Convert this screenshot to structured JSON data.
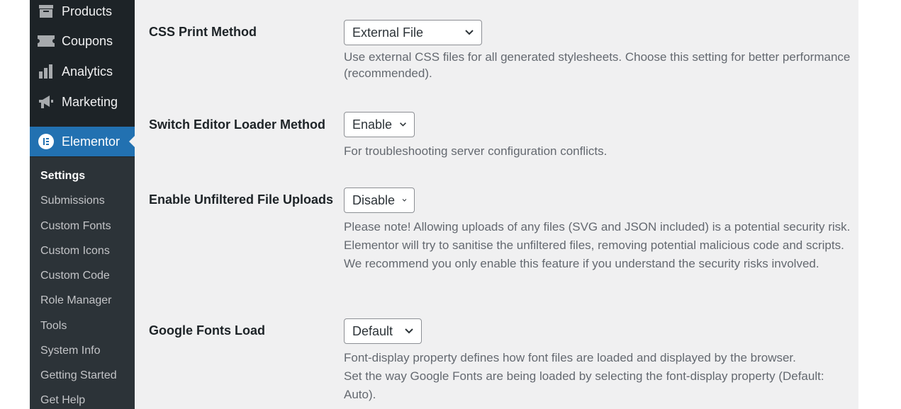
{
  "sidebar": {
    "menu": [
      {
        "label": "Products",
        "icon": "archive-icon"
      },
      {
        "label": "Coupons",
        "icon": "ticket-icon"
      },
      {
        "label": "Analytics",
        "icon": "bar-chart-icon"
      },
      {
        "label": "Marketing",
        "icon": "megaphone-icon"
      },
      {
        "label": "Elementor",
        "icon": "elementor-logo-icon"
      }
    ],
    "submenu": [
      {
        "label": "Settings"
      },
      {
        "label": "Submissions"
      },
      {
        "label": "Custom Fonts"
      },
      {
        "label": "Custom Icons"
      },
      {
        "label": "Custom Code"
      },
      {
        "label": "Role Manager"
      },
      {
        "label": "Tools"
      },
      {
        "label": "System Info"
      },
      {
        "label": "Getting Started"
      },
      {
        "label": "Get Help"
      }
    ],
    "colors": {
      "base": "#1d2327",
      "active": "#2271b1",
      "submenu_bg": "#2c3338"
    }
  },
  "settings": [
    {
      "label": "CSS Print Method",
      "value": "External File",
      "description": [
        "Use external CSS files for all generated stylesheets. Choose this setting for better performance (recommended)."
      ]
    },
    {
      "label": "Switch Editor Loader Method",
      "value": "Enable",
      "description": [
        "For troubleshooting server configuration conflicts."
      ]
    },
    {
      "label": "Enable Unfiltered File Uploads",
      "value": "Disable",
      "description": [
        "Please note! Allowing uploads of any files (SVG and JSON included) is a potential security risk.",
        "Elementor will try to sanitise the unfiltered files, removing potential malicious code and scripts.",
        "We recommend you only enable this feature if you understand the security risks involved."
      ]
    },
    {
      "label": "Google Fonts Load",
      "value": "Default",
      "description": [
        "Font-display property defines how font files are loaded and displayed by the browser.",
        "Set the way Google Fonts are being loaded by selecting the font-display property (Default: Auto)."
      ]
    }
  ]
}
